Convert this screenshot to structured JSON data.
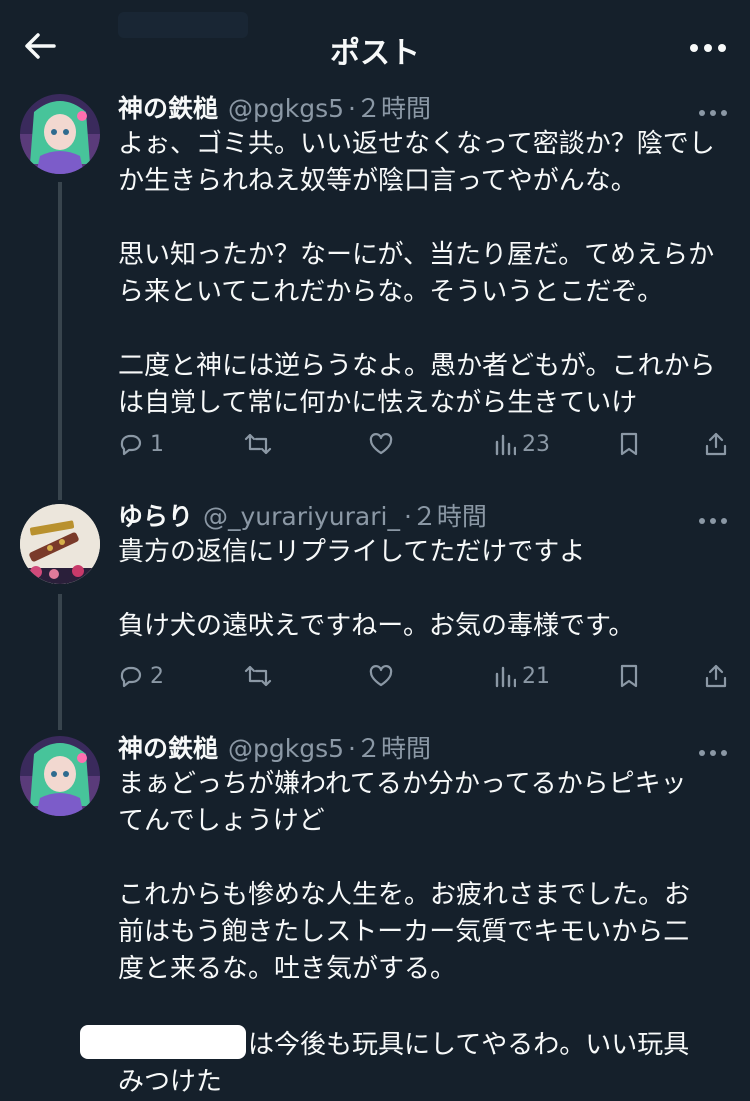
{
  "header": {
    "title": "ポスト"
  },
  "tweets": [
    {
      "name": "神の鉄槌",
      "handle": "@pgkgs5",
      "time": "·２時間",
      "paragraphs": [
        [
          "よぉ、ゴミ共。いい返せなくなって密談か？陰でし",
          "か生きられねえ奴等が陰口言ってやがんな。"
        ],
        [
          "思い知ったか？なーにが、当たり屋だ。てめえらか",
          "ら来といてこれだからな。そういうとこだぞ。"
        ],
        [
          "二度と神には逆らうなよ。愚か者どもが。これから",
          "は自覚して常に何かに怯えながら生きていけ"
        ]
      ],
      "replies": "1",
      "views": "23"
    },
    {
      "name": "ゆらり",
      "handle": "@_yurariyurari_",
      "time": "·２時間",
      "paragraphs": [
        [
          "貴方の返信にリプライしてただけですよ"
        ],
        [
          "負け犬の遠吠えですねー。お気の毒様です。"
        ]
      ],
      "replies": "2",
      "views": "21"
    },
    {
      "name": "神の鉄槌",
      "handle": "@pgkgs5",
      "time": "·２時間",
      "paragraphs": [
        [
          "まぁどっちが嫌われてるか分かってるからピキッ",
          "てんでしょうけど"
        ],
        [
          "これからも惨めな人生を。お疲れさまでした。お",
          "前はもう飽きたしストーカー気質でキモいから二",
          "度と来るな。吐き気がする。"
        ]
      ],
      "last_para_line1": "は今後も玩具にしてやるわ。いい玩具",
      "last_para_line2": "みつけた"
    }
  ],
  "colors": {
    "background": "#15202b",
    "text": "#f7f9f9",
    "muted": "#8b98a5",
    "thread": "#38444d"
  }
}
